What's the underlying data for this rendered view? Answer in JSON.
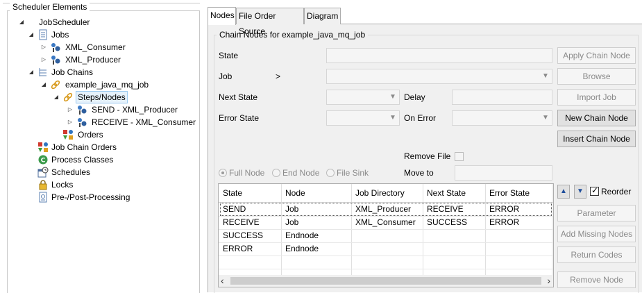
{
  "tree": {
    "title": "Scheduler Elements",
    "nodes": [
      {
        "label": "JobScheduler"
      },
      {
        "label": "Jobs"
      },
      {
        "label": "XML_Consumer"
      },
      {
        "label": "XML_Producer"
      },
      {
        "label": "Job Chains"
      },
      {
        "label": "example_java_mq_job"
      },
      {
        "label": "Steps/Nodes"
      },
      {
        "label": "SEND - XML_Producer"
      },
      {
        "label": "RECEIVE - XML_Consumer"
      },
      {
        "label": "Orders"
      },
      {
        "label": "Job Chain Orders"
      },
      {
        "label": "Process Classes"
      },
      {
        "label": "Schedules"
      },
      {
        "label": "Locks"
      },
      {
        "label": "Pre-/Post-Processing"
      }
    ]
  },
  "tabs": [
    {
      "label": "Nodes"
    },
    {
      "label": "File Order Source"
    },
    {
      "label": "Diagram"
    }
  ],
  "group_title": "Chain Nodes for example_java_mq_job",
  "form": {
    "state_label": "State",
    "job_label": "Job",
    "job_arrow": ">",
    "next_state_label": "Next State",
    "delay_label": "Delay",
    "error_state_label": "Error State",
    "on_error_label": "On Error",
    "remove_file_label": "Remove File",
    "move_to_label": "Move to",
    "reorder_label": "Reorder"
  },
  "radios": {
    "full_node": "Full Node",
    "end_node": "End Node",
    "file_sink": "File Sink"
  },
  "buttons": {
    "apply_chain_node": "Apply Chain Node",
    "browse": "Browse",
    "import_job": "Import Job",
    "new_chain_node": "New Chain Node",
    "insert_chain_node": "Insert Chain Node",
    "parameter": "Parameter",
    "add_missing_nodes": "Add Missing Nodes",
    "return_codes": "Return Codes",
    "remove_node": "Remove Node"
  },
  "table": {
    "columns": [
      "State",
      "Node",
      "Job Directory",
      "Next State",
      "Error State"
    ],
    "rows": [
      [
        "SEND",
        "Job",
        "XML_Producer",
        "RECEIVE",
        "ERROR"
      ],
      [
        "RECEIVE",
        "Job",
        "XML_Consumer",
        "SUCCESS",
        "ERROR"
      ],
      [
        "SUCCESS",
        "Endnode",
        "",
        "",
        ""
      ],
      [
        "ERROR",
        "Endnode",
        "",
        "",
        ""
      ]
    ]
  },
  "icons": {
    "scroll_left": "‹",
    "scroll_right": "›",
    "move_up": "▲",
    "move_down": "▼"
  }
}
